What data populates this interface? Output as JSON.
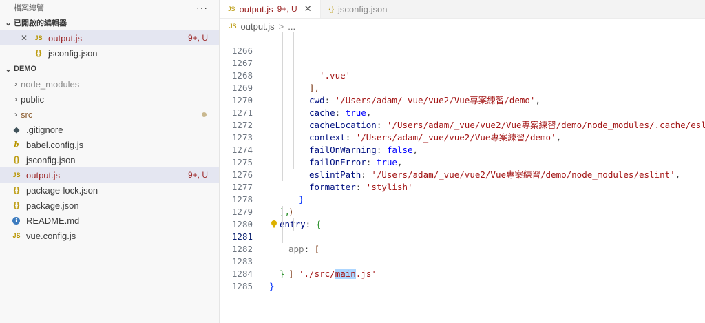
{
  "sidebar": {
    "header": "檔案總管",
    "more": "···",
    "open_editors_title": "已開啟的編輯器",
    "open_editors": [
      {
        "close": "✕",
        "icon": "JS",
        "name": "output.js",
        "badge": "9+, U"
      },
      {
        "icon": "{}",
        "name": "jsconfig.json"
      }
    ],
    "project_title": "DEMO",
    "tree": [
      {
        "name": "node_modules",
        "kind": "folder"
      },
      {
        "name": "public",
        "kind": "folder"
      },
      {
        "name": "src",
        "kind": "folder"
      },
      {
        "name": ".gitignore",
        "icon": "◆"
      },
      {
        "name": "babel.config.js",
        "icon": "b"
      },
      {
        "name": "jsconfig.json",
        "icon": "{}"
      },
      {
        "name": "output.js",
        "icon": "JS",
        "badge": "9+, U"
      },
      {
        "name": "package-lock.json",
        "icon": "{}"
      },
      {
        "name": "package.json",
        "icon": "{}"
      },
      {
        "name": "README.md",
        "icon": "i"
      },
      {
        "name": "vue.config.js",
        "icon": "JS"
      }
    ]
  },
  "tabs": [
    {
      "icon": "JS",
      "label": "output.js",
      "badge": "9+, U",
      "close": "✕"
    },
    {
      "icon": "{}",
      "label": "jsconfig.json"
    }
  ],
  "breadcrumb": {
    "icon": "JS",
    "file": "output.js",
    "sep": ">",
    "more": "..."
  },
  "code": {
    "line_numbers": [
      "1266",
      "1267",
      "1268",
      "1269",
      "1270",
      "1271",
      "1272",
      "1273",
      "1274",
      "1275",
      "1276",
      "1277",
      "1278",
      "1279",
      "1280",
      "1281",
      "1282",
      "1283",
      "1284",
      "1285"
    ],
    "current_line": "1281",
    "l1266": "'.vue'",
    "l1267": "],",
    "l1268_key": "cwd",
    "l1268_val": "'/Users/adam/_vue/vue2/Vue專案練習/demo'",
    "l1269_key": "cache",
    "l1269_val": "true",
    "l1270_key": "cacheLocation",
    "l1270_val": "'/Users/adam/_vue/vue2/Vue專案練習/demo/node_modules/.cache/eslint/'",
    "l1271_key": "context",
    "l1271_val": "'/Users/adam/_vue/vue2/Vue專案練習/demo'",
    "l1272_key": "failOnWarning",
    "l1272_val": "false",
    "l1273_key": "failOnError",
    "l1273_val": "true",
    "l1274_key": "eslintPath",
    "l1274_val": "'/Users/adam/_vue/vue2/Vue專案練習/demo/node_modules/eslint'",
    "l1275_key": "formatter",
    "l1275_val": "'stylish'",
    "l1276": "}",
    "l1277": ")",
    "l1278": "],",
    "l1279_key": "entry",
    "l1279_open": "{",
    "l1280_key": "app",
    "l1280_open": "[",
    "l1281_a": "'./src/",
    "l1281_hl": "main",
    "l1281_b": ".js'",
    "l1282": "]",
    "l1283": "}",
    "l1284": "}"
  }
}
